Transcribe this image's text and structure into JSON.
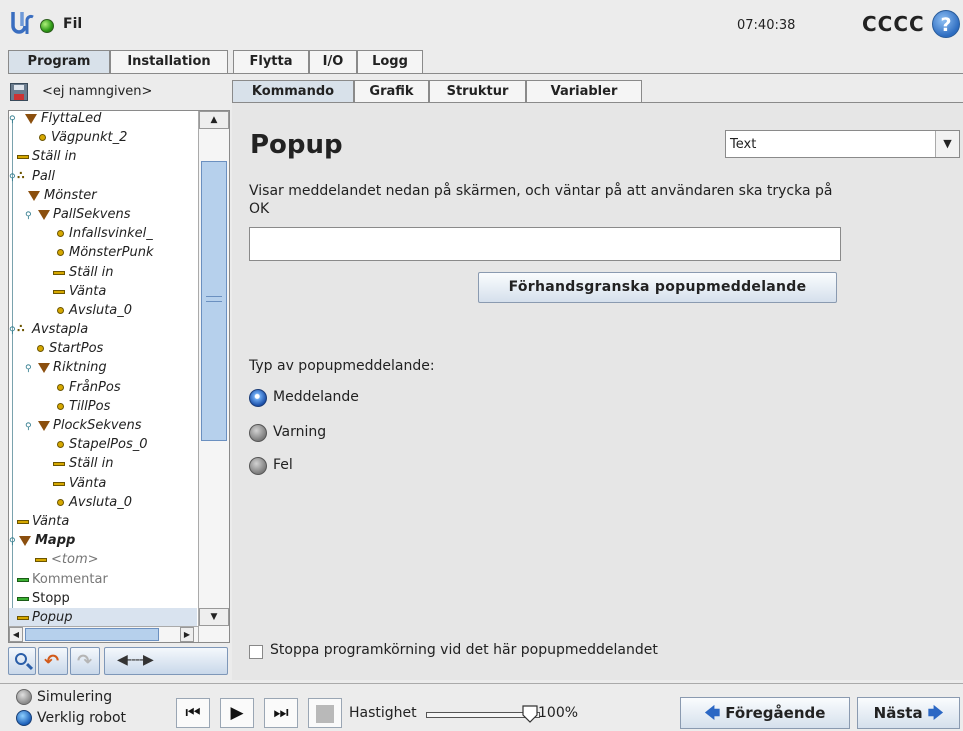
{
  "app": {
    "name": "Fil",
    "time": "07:40:38",
    "robot_name": "CCCC"
  },
  "top_tabs": [
    {
      "label": "Program",
      "active": true
    },
    {
      "label": "Installation",
      "active": false
    },
    {
      "label": "Flytta",
      "active": false
    },
    {
      "label": "I/O",
      "active": false
    },
    {
      "label": "Logg",
      "active": false
    }
  ],
  "program": {
    "name": "<ej namngiven>"
  },
  "tree": [
    {
      "label": "FlyttaLed",
      "icon": "move-icon"
    },
    {
      "label": "Vägpunkt_2",
      "icon": "waypoint-icon"
    },
    {
      "label": "Ställ in",
      "icon": "set-icon"
    },
    {
      "label": "Pall",
      "icon": "pallet-icon"
    },
    {
      "label": "Mönster",
      "icon": "pattern-icon"
    },
    {
      "label": "PallSekvens",
      "icon": "sequence-icon"
    },
    {
      "label": "Infallsvinkel_",
      "icon": "waypoint-icon"
    },
    {
      "label": "MönsterPunk",
      "icon": "waypoint-icon"
    },
    {
      "label": "Ställ in",
      "icon": "set-icon"
    },
    {
      "label": "Vänta",
      "icon": "wait-icon"
    },
    {
      "label": "Avsluta_0",
      "icon": "waypoint-icon"
    },
    {
      "label": "Avstapla",
      "icon": "pallet-icon"
    },
    {
      "label": "StartPos",
      "icon": "waypoint-icon"
    },
    {
      "label": "Riktning",
      "icon": "direction-icon"
    },
    {
      "label": "FrånPos",
      "icon": "waypoint-icon"
    },
    {
      "label": "TillPos",
      "icon": "waypoint-icon"
    },
    {
      "label": "PlockSekvens",
      "icon": "sequence-icon"
    },
    {
      "label": "StapelPos_0",
      "icon": "waypoint-icon"
    },
    {
      "label": "Ställ in",
      "icon": "set-icon"
    },
    {
      "label": "Vänta",
      "icon": "wait-icon"
    },
    {
      "label": "Avsluta_0",
      "icon": "waypoint-icon"
    },
    {
      "label": "Vänta",
      "icon": "wait-icon"
    },
    {
      "label": "Mapp",
      "icon": "folder-icon"
    },
    {
      "label": "<tom>",
      "icon": "empty-icon"
    },
    {
      "label": "Kommentar",
      "icon": "comment-icon"
    },
    {
      "label": "Stopp",
      "icon": "stop-icon"
    },
    {
      "label": "Popup",
      "icon": "popup-icon"
    }
  ],
  "command_tabs": [
    {
      "label": "Kommando",
      "active": true
    },
    {
      "label": "Grafik",
      "active": false
    },
    {
      "label": "Struktur",
      "active": false
    },
    {
      "label": "Variabler",
      "active": false
    }
  ],
  "popup": {
    "title": "Popup",
    "type_select_value": "Text",
    "description": "Visar meddelandet nedan på skärmen, och väntar på att användaren ska trycka på OK",
    "message_value": "",
    "preview_button": "Förhandsgranska popupmeddelande",
    "type_label": "Typ av popupmeddelande:",
    "types": [
      {
        "label": "Meddelande",
        "selected": true
      },
      {
        "label": "Varning",
        "selected": false
      },
      {
        "label": "Fel",
        "selected": false
      }
    ],
    "stop_checkbox_label": "Stoppa programkörning vid det här popupmeddelandet",
    "stop_checked": false
  },
  "footer": {
    "simulation_label": "Simulering",
    "real_robot_label": "Verklig robot",
    "speed_label": "Hastighet",
    "speed_value": "100%",
    "speed_fraction": 1.0,
    "prev_label": "Föregående",
    "next_label": "Nästa"
  },
  "colors": {
    "status_ok": "#2e9a17",
    "accent": "#2b67c4",
    "selected_bg": "#d9e3ef"
  }
}
